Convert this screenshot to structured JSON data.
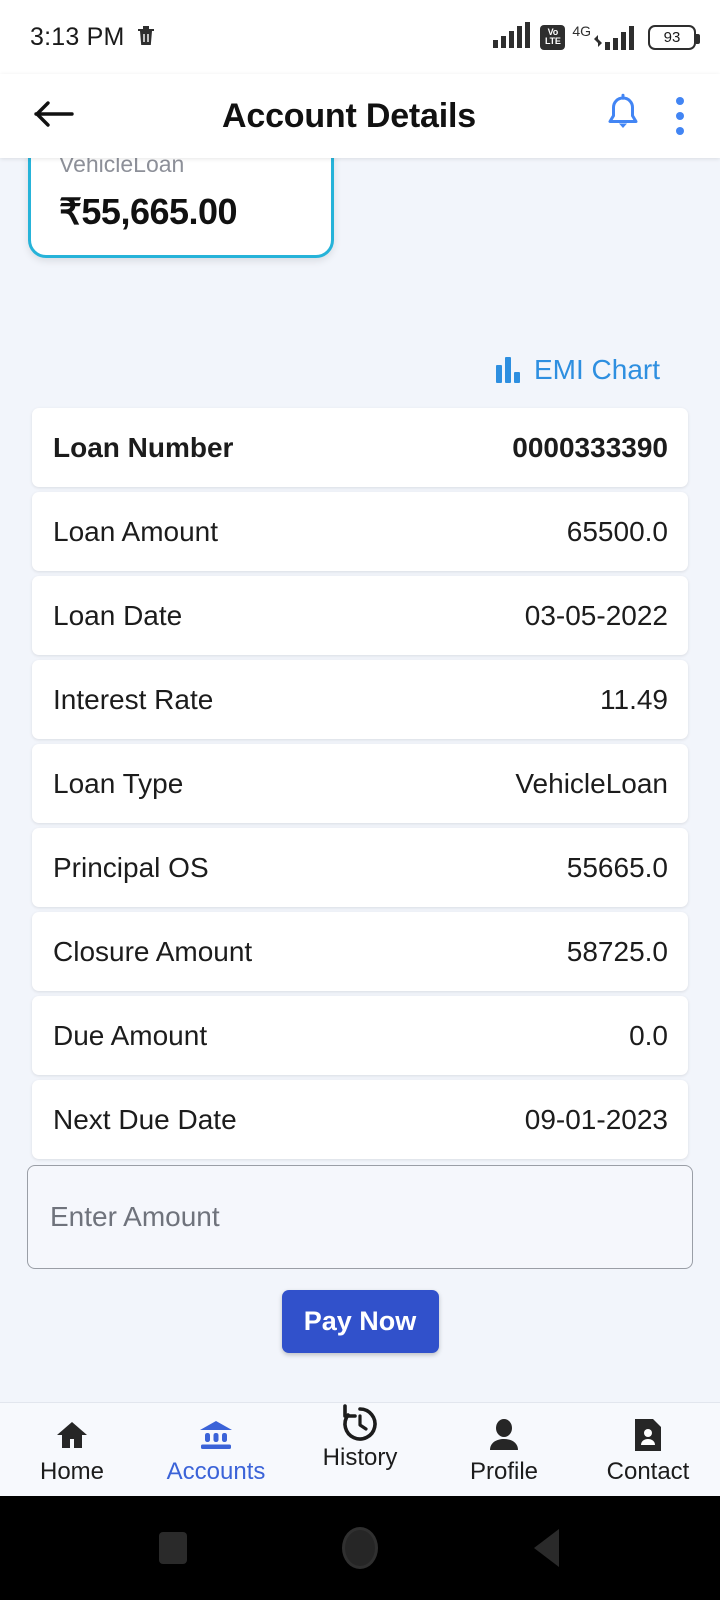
{
  "status_bar": {
    "time": "3:13 PM",
    "trash_icon": "trash-icon",
    "network_icon": "signal-bars-icon",
    "volte_line1": "Vo",
    "volte_line2": "LTE",
    "network_type": "4G",
    "battery_level": "93"
  },
  "app_bar": {
    "back_icon": "back-arrow-icon",
    "title": "Account Details",
    "bell_icon": "bell-icon",
    "overflow_icon": "three-dot-menu-icon",
    "accent_color": "#4285f4"
  },
  "account_card": {
    "type": "VehicleLoan",
    "balance": "₹55,665.00",
    "border_color": "#26b3d9"
  },
  "emi_link": {
    "icon": "bar-chart-icon",
    "label": "EMI Chart",
    "color": "#2e8fe0"
  },
  "details": [
    {
      "label": "Loan Number",
      "value": "0000333390",
      "primary": true
    },
    {
      "label": "Loan Amount",
      "value": "65500.0",
      "primary": false
    },
    {
      "label": "Loan Date",
      "value": "03-05-2022",
      "primary": false
    },
    {
      "label": "Interest Rate",
      "value": "11.49",
      "primary": false
    },
    {
      "label": "Loan Type",
      "value": "VehicleLoan",
      "primary": false
    },
    {
      "label": "Principal OS",
      "value": "55665.0",
      "primary": false
    },
    {
      "label": "Closure Amount",
      "value": "58725.0",
      "primary": false
    },
    {
      "label": "Due Amount",
      "value": "0.0",
      "primary": false
    },
    {
      "label": "Next Due Date",
      "value": "09-01-2023",
      "primary": false
    }
  ],
  "amount_input": {
    "placeholder": "Enter Amount",
    "value": ""
  },
  "pay_button": {
    "label": "Pay Now",
    "color": "#3151cb"
  },
  "bottom_nav": {
    "active_color": "#3b63d8",
    "items": [
      {
        "label": "Home",
        "icon": "home-icon",
        "active": false
      },
      {
        "label": "Accounts",
        "icon": "bank-icon",
        "active": true
      },
      {
        "label": "History",
        "icon": "history-icon",
        "active": false
      },
      {
        "label": "Profile",
        "icon": "person-icon",
        "active": false
      },
      {
        "label": "Contact",
        "icon": "contact-card-icon",
        "active": false
      }
    ]
  },
  "system_nav": {
    "recents_icon": "square-recents-icon",
    "home_icon": "circle-home-icon",
    "back_icon": "triangle-back-icon"
  }
}
